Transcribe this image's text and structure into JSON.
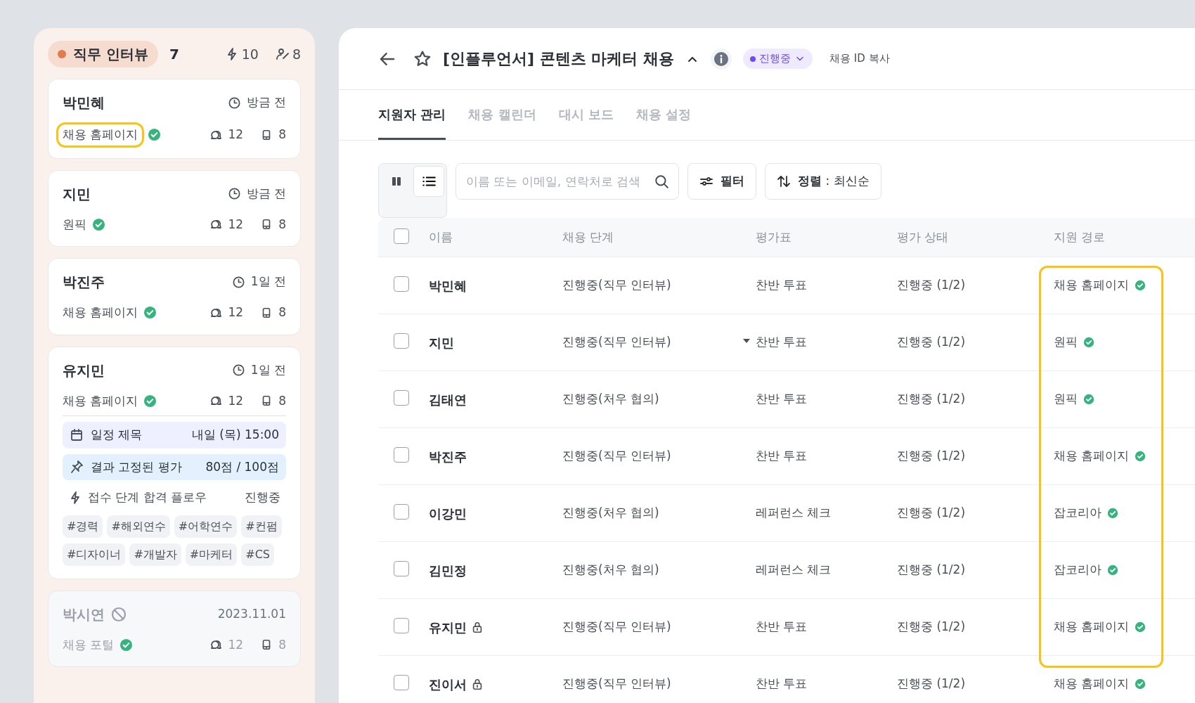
{
  "stage": {
    "name": "직무 인터뷰",
    "color": "#e07b50",
    "count": "7",
    "flows": "10",
    "members": "8"
  },
  "cards": [
    {
      "name": "박민혜",
      "time": "방금 전",
      "source": "채용 홈페이지",
      "verified": true,
      "comments": "12",
      "documents": "8",
      "highlighted": true,
      "disabled": false
    },
    {
      "name": "지민",
      "time": "방금 전",
      "source": "원픽",
      "verified": true,
      "comments": "12",
      "documents": "8",
      "highlighted": false,
      "disabled": false
    },
    {
      "name": "박진주",
      "time": "1일 전",
      "source": "채용 홈페이지",
      "verified": true,
      "comments": "12",
      "documents": "8",
      "highlighted": false,
      "disabled": false
    },
    {
      "name": "유지민",
      "time": "1일 전",
      "source": "채용 홈페이지",
      "verified": true,
      "comments": "12",
      "documents": "8",
      "highlighted": false,
      "disabled": false,
      "details": {
        "schedule": {
          "title": "일정 제목",
          "when": "내일 (목) 15:00"
        },
        "pinned": {
          "title": "결과 고정된 평가",
          "score": "80점 / 100점"
        },
        "flow": {
          "title": "접수 단계 합격 플로우",
          "status": "진행중"
        },
        "tags": [
          "#경력",
          "#해외연수",
          "#어학연수",
          "#컨펌",
          "#디자이너",
          "#개발자",
          "#마케터",
          "#CS"
        ]
      }
    },
    {
      "name": "박시연",
      "time": "2023.11.01",
      "source": "채용 포털",
      "verified": true,
      "comments": "12",
      "documents": "8",
      "highlighted": false,
      "disabled": true
    }
  ],
  "header": {
    "title": "[인플루언서] 콘텐츠 마케터 채용",
    "starred": false,
    "status": "진행중",
    "copy_label": "채용 ID 복사"
  },
  "tabs": [
    {
      "label": "지원자 관리",
      "selected": true
    },
    {
      "label": "채용 캘린더",
      "selected": false
    },
    {
      "label": "대시 보드",
      "selected": false
    },
    {
      "label": "채용 설정",
      "selected": false
    }
  ],
  "toolbar": {
    "views": [
      {
        "kind": "board",
        "selected": false
      },
      {
        "kind": "list",
        "selected": true
      }
    ],
    "search_placeholder": "이름 또는 이메일, 연락처로 검색",
    "filter_label": "필터",
    "sort_label": "**정렬** : 최신순"
  },
  "table": {
    "all_checked": false,
    "columns": [
      {
        "label": "이름",
        "highlighted": false
      },
      {
        "label": "채용 단계",
        "highlighted": false
      },
      {
        "label": "평가표",
        "highlighted": false
      },
      {
        "label": "평가 상태",
        "highlighted": false
      },
      {
        "label": "지원 경로",
        "highlighted": true
      }
    ],
    "rows": [
      {
        "checked": false,
        "name": "박민혜",
        "locked": false,
        "stage": "진행중(직무 인터뷰)",
        "scorecard": "찬반 투표",
        "caret": false,
        "status": "진행중 (1/2)",
        "source": "채용 홈페이지",
        "verified": true
      },
      {
        "checked": false,
        "name": "지민",
        "locked": false,
        "stage": "진행중(직무 인터뷰)",
        "scorecard": "찬반 투표",
        "caret": true,
        "status": "진행중 (1/2)",
        "source": "원픽",
        "verified": true
      },
      {
        "checked": false,
        "name": "김태연",
        "locked": false,
        "stage": "진행중(처우 협의)",
        "scorecard": "찬반 투표",
        "caret": false,
        "status": "진행중 (1/2)",
        "source": "원픽",
        "verified": true
      },
      {
        "checked": false,
        "name": "박진주",
        "locked": false,
        "stage": "진행중(직무 인터뷰)",
        "scorecard": "찬반 투표",
        "caret": false,
        "status": "진행중 (1/2)",
        "source": "채용 홈페이지",
        "verified": true
      },
      {
        "checked": false,
        "name": "이강민",
        "locked": false,
        "stage": "진행중(처우 협의)",
        "scorecard": "레퍼런스 체크",
        "caret": false,
        "status": "진행중 (1/2)",
        "source": "잡코리아",
        "verified": true
      },
      {
        "checked": false,
        "name": "김민정",
        "locked": false,
        "stage": "진행중(처우 협의)",
        "scorecard": "레퍼런스 체크",
        "caret": false,
        "status": "진행중 (1/2)",
        "source": "잡코리아",
        "verified": true
      },
      {
        "checked": false,
        "name": "유지민",
        "locked": true,
        "stage": "진행중(직무 인터뷰)",
        "scorecard": "찬반 투표",
        "caret": false,
        "status": "진행중 (1/2)",
        "source": "채용 홈페이지",
        "verified": true
      },
      {
        "checked": false,
        "name": "진이서",
        "locked": true,
        "stage": "진행중(직무 인터뷰)",
        "scorecard": "찬반 투표",
        "caret": false,
        "status": "진행중 (1/2)",
        "source": "채용 홈페이지",
        "verified": true
      }
    ]
  }
}
